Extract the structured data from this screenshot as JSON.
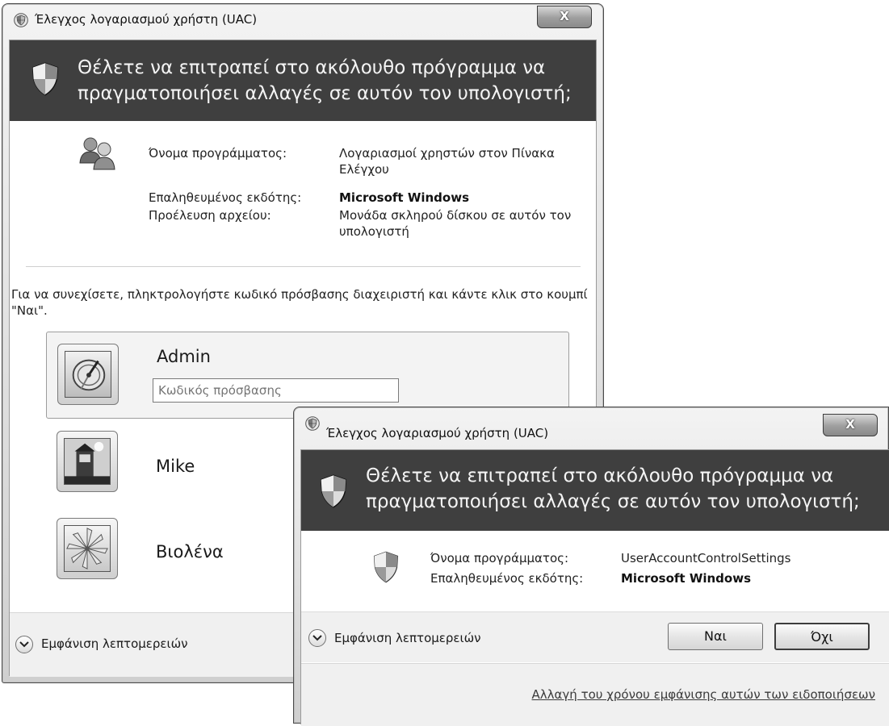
{
  "back_dialog": {
    "title": "Έλεγχος λογαριασμού χρήστη (UAC)",
    "close_label": "X",
    "question": "Θέλετε να επιτραπεί στο ακόλουθο πρόγραμμα να πραγματοποιήσει αλλαγές σε αυτόν τον υπολογιστή;",
    "details": {
      "program_name_label": "Όνομα προγράμματος:",
      "program_name_value": "Λογαριασμοί χρηστών στον Πίνακα Ελέγχου",
      "publisher_label": "Επαληθευμένος εκδότης:",
      "publisher_value": "Microsoft Windows",
      "origin_label": "Προέλευση αρχείου:",
      "origin_value": "Μονάδα σκληρού δίσκου σε αυτόν τον υπολογιστή"
    },
    "instruction": "Για να συνεχίσετε, πληκτρολογήστε κωδικό πρόσβασης διαχειριστή και κάντε κλικ στο κουμπί \"Ναι\".",
    "users": [
      {
        "name": "Admin",
        "password_placeholder": "Κωδικός πρόσβασης",
        "selected": true
      },
      {
        "name": "Mike"
      },
      {
        "name": "Βιολένα"
      }
    ],
    "show_details": "Εμφάνιση λεπτομερειών"
  },
  "front_dialog": {
    "title": "Έλεγχος λογαριασμού χρήστη (UAC)",
    "close_label": "X",
    "question": "Θέλετε να επιτραπεί στο ακόλουθο πρόγραμμα να πραγματοποιήσει αλλαγές σε αυτόν τον υπολογιστή;",
    "details": {
      "program_name_label": "Όνομα προγράμματος:",
      "program_name_value": "UserAccountControlSettings",
      "publisher_label": "Επαληθευμένος εκδότης:",
      "publisher_value": "Microsoft Windows"
    },
    "show_details": "Εμφάνιση λεπτομερειών",
    "yes_label": "Ναι",
    "no_label": "Όχι",
    "change_link": "Αλλαγή του χρόνου εμφάνισης αυτών των ειδοποιήσεων"
  },
  "icons": {
    "title_icon": "uac-shield-icon",
    "header_icon": "uac-shield-icon",
    "program_icon_back": "user-accounts-icon",
    "program_icon_front": "uac-shield-icon",
    "expand_icon": "chevron-down-icon"
  },
  "colors": {
    "header_band": "#3f3f3f",
    "header_text": "#f4f4f4"
  }
}
